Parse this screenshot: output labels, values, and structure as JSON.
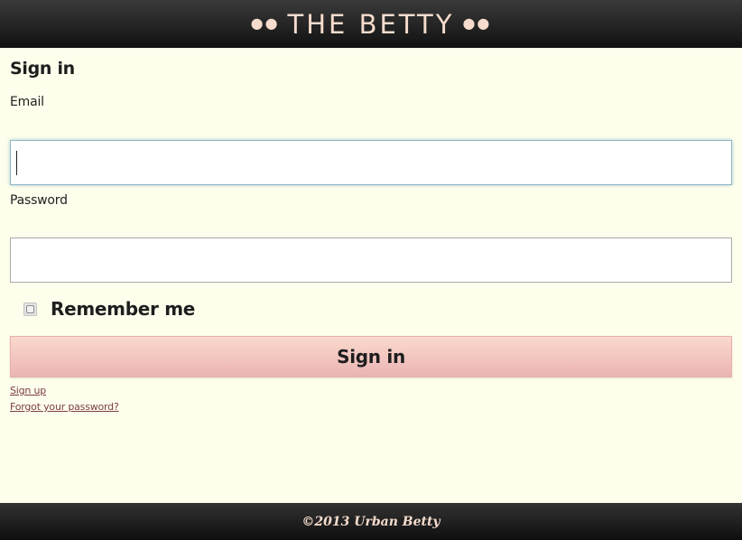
{
  "header": {
    "left_dots": "●●",
    "brand": "THE BETTY",
    "right_dots": "●●"
  },
  "form": {
    "title": "Sign in",
    "email_label": "Email",
    "email_value": "",
    "password_label": "Password",
    "password_value": "",
    "remember_label": "Remember me",
    "remember_checked": false,
    "submit_label": "Sign in"
  },
  "links": {
    "signup": "Sign up",
    "forgot": "Forgot your password?"
  },
  "footer": {
    "copyright": "©2013 Urban Betty"
  },
  "colors": {
    "background": "#fefeec",
    "header_text": "#f6dccd",
    "button_top": "#fad9cd",
    "button_bottom": "#ebb4b4",
    "link": "#7a3d44"
  }
}
